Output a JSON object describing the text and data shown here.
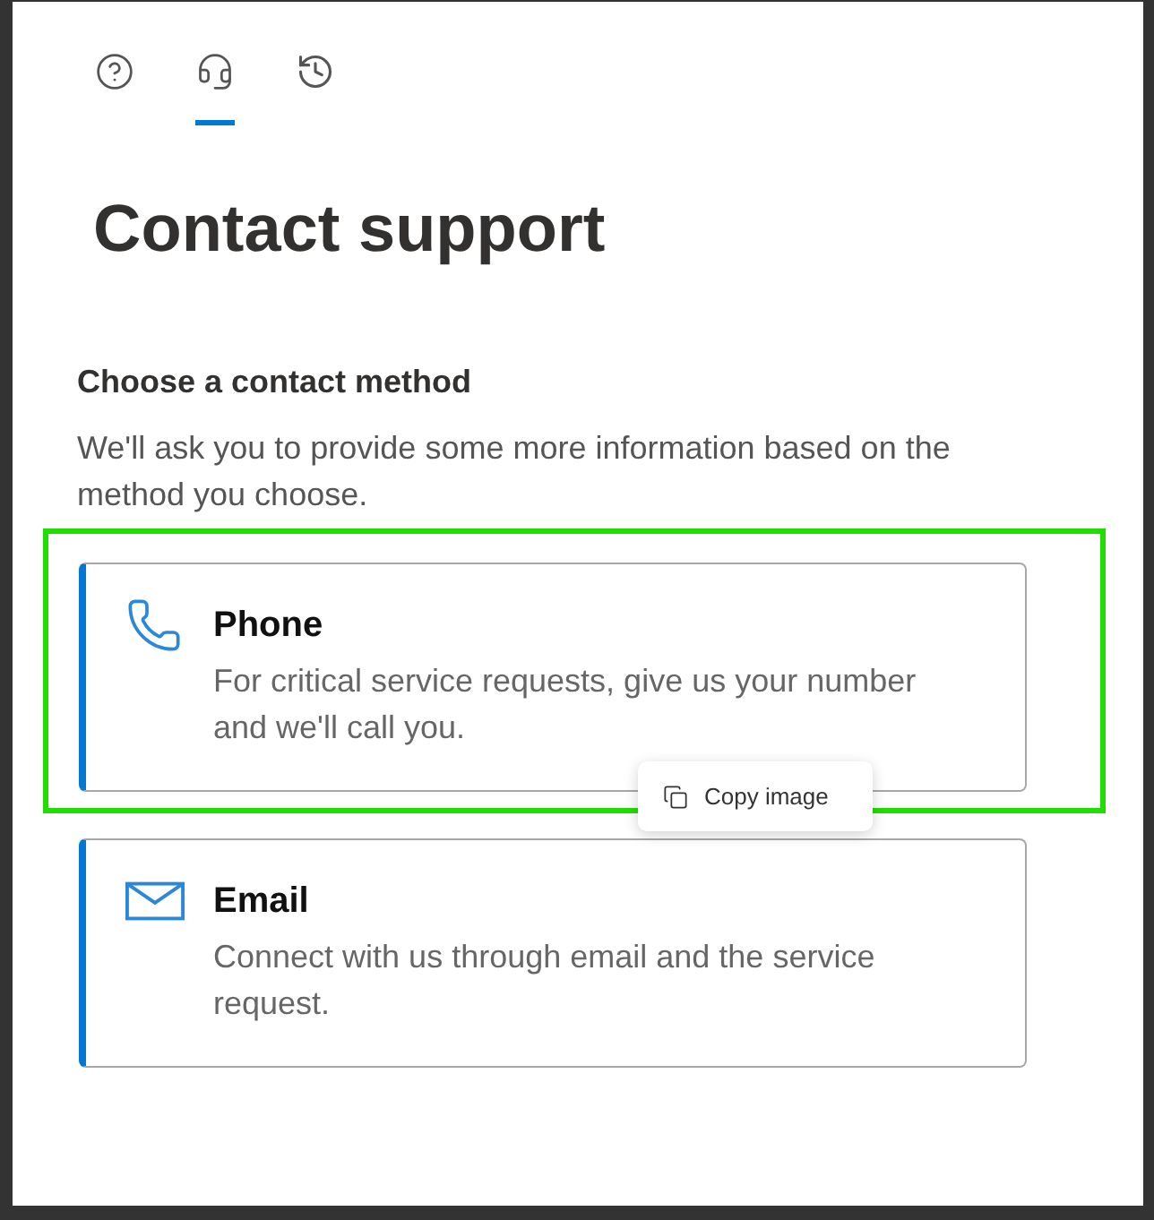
{
  "tabs": [
    {
      "kind": "help",
      "selected": false
    },
    {
      "kind": "support",
      "selected": true
    },
    {
      "kind": "history",
      "selected": false
    }
  ],
  "title": "Contact support",
  "section": {
    "heading": "Choose a contact method",
    "description": "We'll ask you to provide some more information based on the method you choose."
  },
  "methods": [
    {
      "kind": "phone",
      "title": "Phone",
      "description": "For critical service requests, give us your number and we'll call you.",
      "highlighted": true
    },
    {
      "kind": "email",
      "title": "Email",
      "description": "Connect with us through email and the service request.",
      "highlighted": false
    }
  ],
  "context_menu": {
    "items": [
      {
        "label": "Copy image"
      }
    ]
  }
}
